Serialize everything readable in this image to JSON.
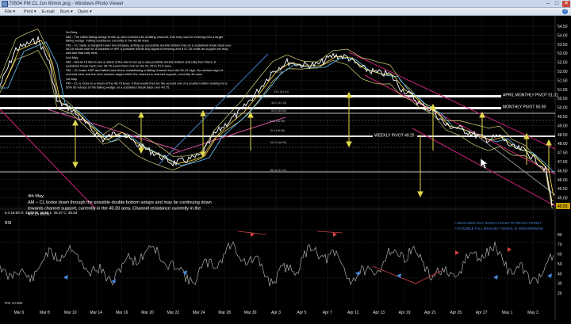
{
  "window": {
    "title": "170504 PM CL Jun 60min.png - Windows Photo Viewer",
    "minimize_glyph": "–",
    "maximize_glyph": "□",
    "close_glyph": "✕",
    "colors": {
      "titlebar": "#c9d7ea",
      "close": "#c8453a"
    }
  },
  "menu": {
    "file": "File ▾",
    "print": "Print ▾",
    "email": "E-mail",
    "burn": "Burn ▾",
    "open": "Open ▾",
    "help_glyph": "?"
  },
  "chart": {
    "price_axis": [
      "54.50",
      "54.00",
      "53.50",
      "53.00",
      "52.50",
      "52.00",
      "51.50",
      "51.00",
      "50.50",
      "50.00",
      "49.50",
      "49.00",
      "48.50",
      "48.00",
      "47.50",
      "47.00",
      "46.50",
      "46.00",
      "45.50",
      "45.00",
      "44.50"
    ],
    "rsi_axis": [
      "80",
      "70",
      "60",
      "50",
      "40",
      "30",
      "20"
    ],
    "date_axis": [
      "Mar 6",
      "Mar 8",
      "Mar 10",
      "Mar 14",
      "Mar 16",
      "Mar 20",
      "Mar 22",
      "Mar 24",
      "Mar 28",
      "Mar 30",
      "Apr 3",
      "Apr 5",
      "Apr 7",
      "Apr 11",
      "Apr 13",
      "Apr 19",
      "Apr 21",
      "Apr 25",
      "Apr 27",
      "May 1",
      "May 3"
    ],
    "level_labels": {
      "april_pivot": "APRIL MONTHLY PIVOT 51.31",
      "monthly_pivot": "MONTHLY PIVOT 50.59",
      "weekly_pivot": "WEEKLY PIVOT 49.25",
      "last_price": "45.53"
    },
    "fib_labels": [
      "0.0 (52.30)",
      "23.6 (51.61)",
      "38.2 (51.15)",
      "50.0 (50.84)",
      "61.8 (50.38)",
      "76.4 (49.88)",
      "100.0 (48.99)",
      "161.8 (47.21)"
    ],
    "ohlc_readout": "5.4 16:00  O: 45.63  H: 45.55  L: 45.37  C: 45.53",
    "rsi_label": "RSI",
    "rsi_readout": "RSI  10.905",
    "notes_top": [
      "3rd May",
      "AM – The initial falling wedge broke up and evolved into a falling channel, that may now be evolving into a larger falling wedge. Falling resistance currently in the 48.80 area.",
      "PM – CL made a marginal lower low intraday, setting up a possible double bottom that on a sustained break back over 48.25 would look for a backtest of WP. A possible 60min buy signal is brewing and if 47.25 holds as support we may well see that rally next.",
      "2nd May",
      "AM – Would I'd like to see a retest of the low to set up a new possible double bottom and rally from there. A sustained break back over 48.75 would then look for the 51.25 to 51.5 area.",
      "PM – CL broke HSP and failed back there, establishing a falling channel from the 54.12 high. No obvious sign of reversal here and the next obvious target within the channel is channel support, currently 46 area.",
      "1st May",
      "PM – CL is close to a retest of the 48.75 level. If that would then be the second low of a double bottom looking for a 50% fib retrace of the falling wedge on a sustained break back over 49.75."
    ],
    "notes_bottom": [
      "4th May",
      "AM – CL broke down through the possible double bottom setups and may be continuing down towards channel support, currently in the 45.20 area. Channel resistance currently in the 49.15 area."
    ],
    "rsi_notes": [
      "A 60min 60min BUY SIGNAL FAILED TO REACH TARGET",
      "A POSSIBLE FULL 60min BUY SIGNAL IS NOW BREWING"
    ],
    "series_colors": {
      "price": "#ffffff",
      "bollinger": "#d8d078",
      "ma_fast": "#ffe14a",
      "ma_slow": "#63c8ff",
      "pivot_line": "#ffffff",
      "channel": "#d34b98",
      "down_channel": "#c8227a",
      "rsi": "#c9c9c9",
      "up_arrow": "#e0d84a",
      "fib": "#aeb4c8"
    }
  }
}
